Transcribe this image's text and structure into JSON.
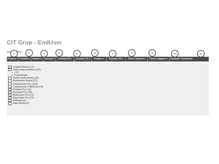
{
  "header": {
    "title": "CIT Grup - EndUser",
    "welcome": "Adi ... Admin"
  },
  "callouts": [
    "1",
    "2",
    "3",
    "4",
    "5",
    "6",
    "7",
    "8",
    "9",
    "10",
    "11"
  ],
  "menu": [
    {
      "label": "Produse ▾"
    },
    {
      "label": "Preturile ▾"
    },
    {
      "label": "Stocuri ▾"
    },
    {
      "label": "Comenzi ▾"
    },
    {
      "label": "Contract RS ▾"
    },
    {
      "label": "Contract CS ▾"
    },
    {
      "label": "Produse ▾"
    },
    {
      "label": "Evaluare ES ▾"
    },
    {
      "label": "Client / Depozit ▾"
    },
    {
      "label": "Client / magazin ▾"
    },
    {
      "label": "Conturile Functionari"
    }
  ],
  "tree": [
    {
      "label": "Legaturi Brand (12)",
      "child": false
    },
    {
      "label": "Calcul Marca Brand (224)",
      "child": false
    },
    {
      "label": "1 CC",
      "child": true
    },
    {
      "label": "PowerMedia",
      "child": true
    },
    {
      "label": "Model Stoffe Brand (63)",
      "child": false
    },
    {
      "label": "Movimetals Brand (27)",
      "child": false
    },
    {
      "label": "Componente Pcr (125)",
      "child": false
    },
    {
      "label": "Componente Platforma (78)",
      "child": false
    },
    {
      "label": "Periferie Pcr (74)",
      "child": false
    },
    {
      "label": "Accesorii Pcr (90)",
      "child": false
    },
    {
      "label": "Notebooks Pcr (17)",
      "child": false
    },
    {
      "label": "Depozitare Pcr (74)",
      "child": false
    },
    {
      "label": "Software (2)",
      "child": false
    },
    {
      "label": "Data Media (2)",
      "child": false
    }
  ]
}
